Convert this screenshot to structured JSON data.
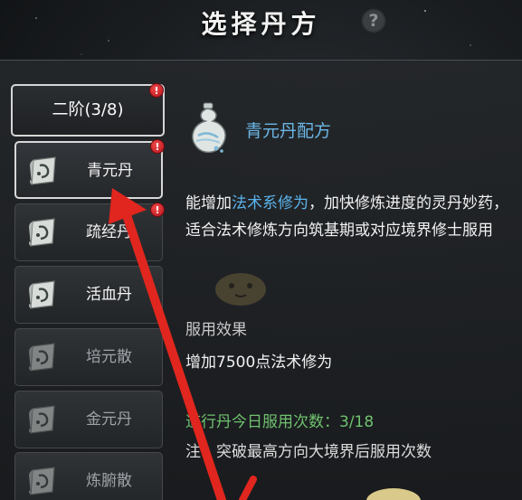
{
  "header": {
    "title": "选择丹方",
    "help_icon": "question-mark-icon",
    "help_glyph": "?"
  },
  "tier": {
    "label": "二阶(3/8)",
    "has_alert": true
  },
  "recipes": [
    {
      "label": "青元丹",
      "selected": true,
      "available": true,
      "alert": true,
      "icon": "scroll-icon"
    },
    {
      "label": "疏经丹",
      "selected": false,
      "available": true,
      "alert": true,
      "icon": "scroll-icon"
    },
    {
      "label": "活血丹",
      "selected": false,
      "available": true,
      "alert": false,
      "icon": "scroll-icon"
    },
    {
      "label": "培元散",
      "selected": false,
      "available": false,
      "alert": false,
      "icon": "scroll-icon"
    },
    {
      "label": "金元丹",
      "selected": false,
      "available": false,
      "alert": false,
      "icon": "scroll-icon"
    },
    {
      "label": "炼腑散",
      "selected": false,
      "available": false,
      "alert": false,
      "icon": "scroll-icon"
    }
  ],
  "detail": {
    "icon": "gourd-icon",
    "title": "青元丹配方",
    "desc_before": "能增加",
    "desc_highlight": "法术系修为",
    "desc_after": "，加快修炼进度的灵丹妙药，适合法术修炼方向筑基期或对应境界修士服用",
    "effect_label": "服用效果",
    "effect_text": "增加7500点法术修为",
    "daily_label": "道行丹今日服用次数：",
    "daily_count": "3/18",
    "note_text": "注：突破最高方向大境界后服用次数"
  },
  "colors": {
    "accent_blue": "#6cb6e6",
    "alert_red": "#d91f26",
    "daily_green": "#6fc26f",
    "annotation_arrow": "#e0261e"
  },
  "annotation_arrows": [
    "red-arrow-pointing-to-first-recipe",
    "red-arrow-from-bottom"
  ]
}
